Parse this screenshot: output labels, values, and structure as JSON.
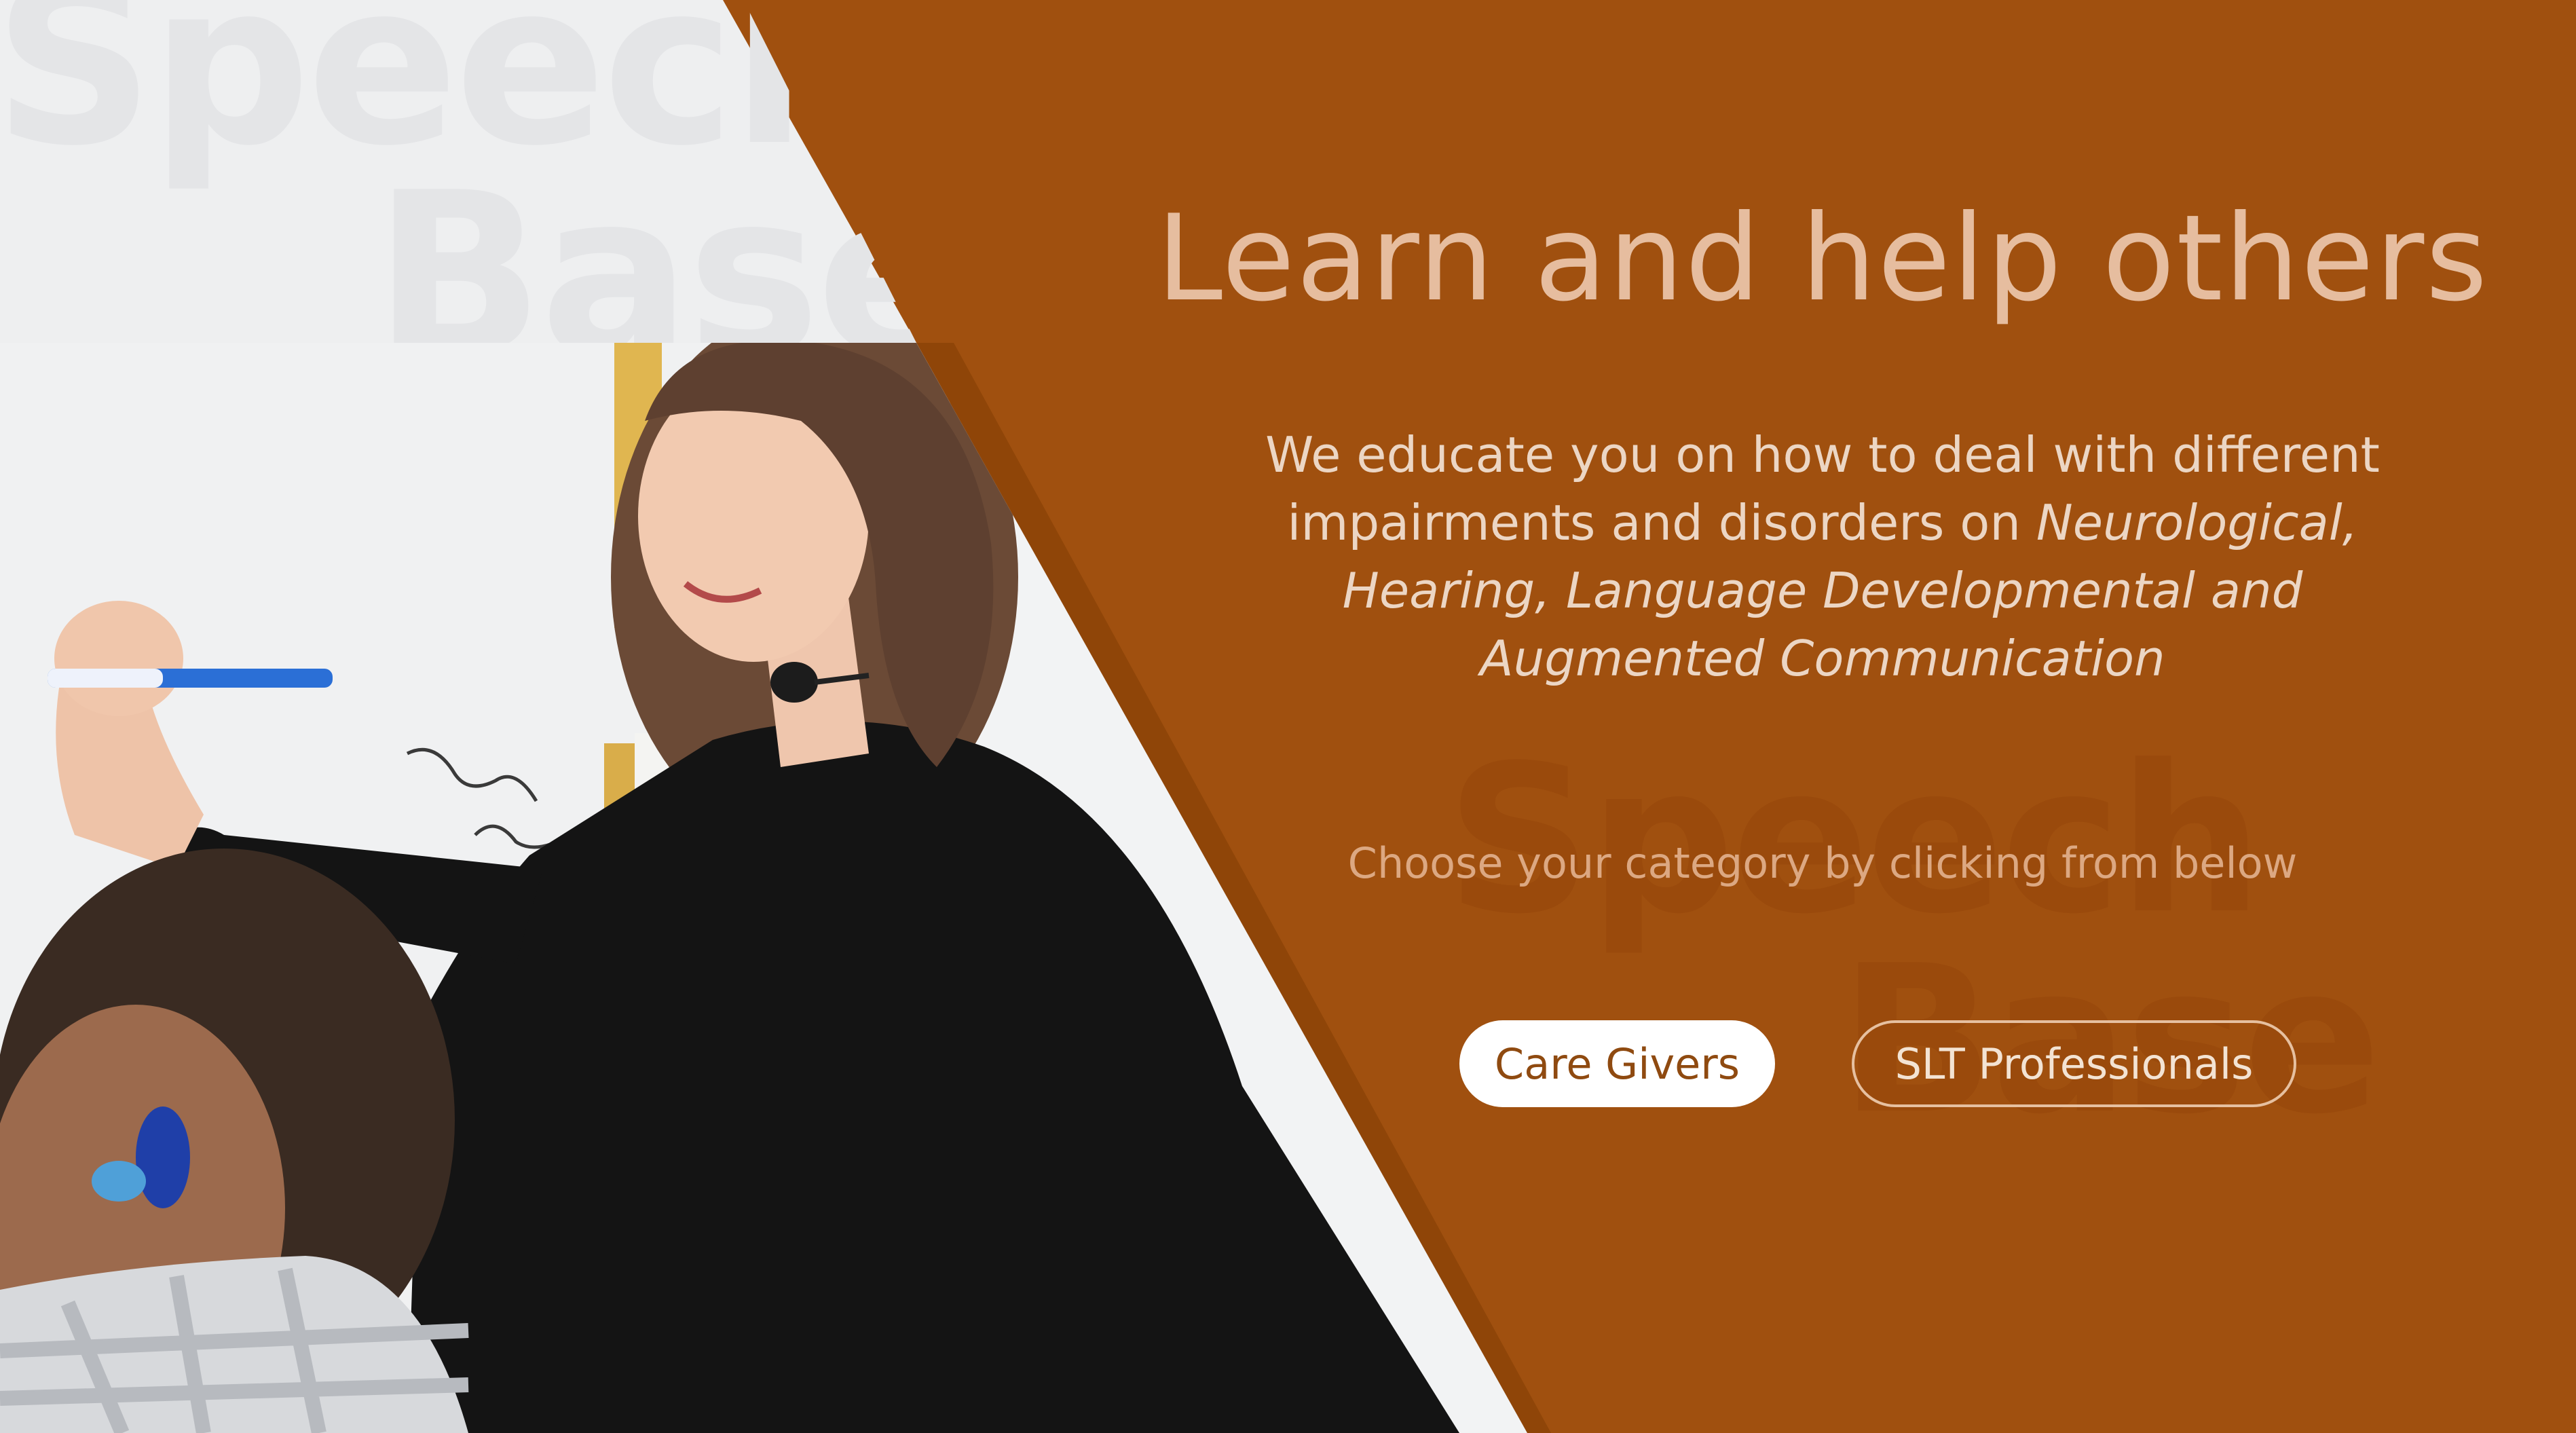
{
  "watermark": {
    "line1": "Speech",
    "line2": "Base"
  },
  "hero": {
    "title": "Learn and help others",
    "intro_plain": "We educate you on how to deal with different impairments and disorders on ",
    "intro_italic": "Neurological, Hearing, Language Developmental and Augmented Communication",
    "prompt": "Choose your category by clicking from below"
  },
  "buttons": {
    "care_givers": "Care Givers",
    "slt_professionals": "SLT Professionals"
  },
  "colors": {
    "background": "#a0500f",
    "band": "#8f4508",
    "panel": "#eeeff0",
    "title": "#e6bd9f",
    "button_primary_bg": "#ffffff",
    "button_primary_text": "#8f4a10"
  }
}
